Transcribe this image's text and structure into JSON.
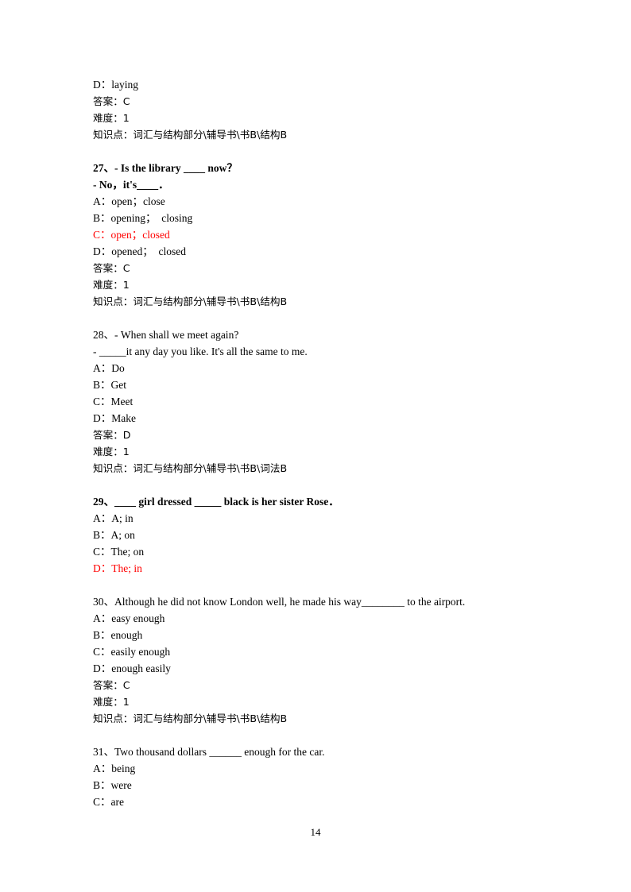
{
  "document": {
    "page_number": "14",
    "accent_color": "#ff0000",
    "text_color": "#000000",
    "background_color": "#ffffff"
  },
  "blocks": [
    {
      "id": "carryover-question",
      "lines": [
        {
          "text": "D：laying",
          "style": "normal",
          "name": "option-line"
        },
        {
          "text": "答案：C",
          "style": "cjk",
          "name": "answer-line"
        },
        {
          "text": "难度：1",
          "style": "cjk",
          "name": "difficulty-line"
        },
        {
          "text": "知识点：词汇与结构部分\\辅导书\\书B\\结构B",
          "style": "cjk",
          "name": "knowledge-point-line"
        }
      ]
    },
    {
      "id": "question-27",
      "lines": [
        {
          "text": "27、- Is the library ____ now？",
          "style": "bold",
          "name": "question-stem"
        },
        {
          "text": "- No，it's____．",
          "style": "bold",
          "name": "question-stem-cont"
        },
        {
          "text": "A：open；close",
          "style": "normal",
          "name": "option-line"
        },
        {
          "text": "B：opening；  closing",
          "style": "normal",
          "name": "option-line"
        },
        {
          "text": "C：open；closed",
          "style": "red",
          "name": "option-line"
        },
        {
          "text": "D：opened；  closed",
          "style": "normal",
          "name": "option-line"
        },
        {
          "text": "答案：C",
          "style": "cjk",
          "name": "answer-line"
        },
        {
          "text": "难度：1",
          "style": "cjk",
          "name": "difficulty-line"
        },
        {
          "text": "知识点：词汇与结构部分\\辅导书\\书B\\结构B",
          "style": "cjk",
          "name": "knowledge-point-line"
        }
      ]
    },
    {
      "id": "question-28",
      "lines": [
        {
          "text": "28、- When shall we meet again?",
          "style": "normal",
          "name": "question-stem"
        },
        {
          "text": "- _____it any day you like. It's all the same to me.",
          "style": "normal",
          "name": "question-stem-cont"
        },
        {
          "text": "A：Do",
          "style": "normal",
          "name": "option-line"
        },
        {
          "text": "B：Get",
          "style": "normal",
          "name": "option-line"
        },
        {
          "text": "C：Meet",
          "style": "normal",
          "name": "option-line"
        },
        {
          "text": "D：Make",
          "style": "normal",
          "name": "option-line"
        },
        {
          "text": "答案：D",
          "style": "cjk",
          "name": "answer-line"
        },
        {
          "text": "难度：1",
          "style": "cjk",
          "name": "difficulty-line"
        },
        {
          "text": "知识点：词汇与结构部分\\辅导书\\书B\\词法B",
          "style": "cjk",
          "name": "knowledge-point-line"
        }
      ]
    },
    {
      "id": "question-29",
      "lines": [
        {
          "text": "29、____ girl dressed _____ black is her sister Rose．",
          "style": "bold",
          "name": "question-stem"
        },
        {
          "text": "A：A; in",
          "style": "normal",
          "name": "option-line"
        },
        {
          "text": "B：A; on",
          "style": "normal",
          "name": "option-line"
        },
        {
          "text": "C：The; on",
          "style": "normal",
          "name": "option-line"
        },
        {
          "text": "D：The; in",
          "style": "red",
          "name": "option-line"
        }
      ]
    },
    {
      "id": "question-30",
      "lines": [
        {
          "text": "30、Although he did not know London well, he made his way________ to the airport.",
          "style": "normal",
          "name": "question-stem"
        },
        {
          "text": "A：easy enough",
          "style": "normal",
          "name": "option-line"
        },
        {
          "text": "B：enough",
          "style": "normal",
          "name": "option-line"
        },
        {
          "text": "C：easily enough",
          "style": "normal",
          "name": "option-line"
        },
        {
          "text": "D：enough easily",
          "style": "normal",
          "name": "option-line"
        },
        {
          "text": "答案：C",
          "style": "cjk",
          "name": "answer-line"
        },
        {
          "text": "难度：1",
          "style": "cjk",
          "name": "difficulty-line"
        },
        {
          "text": "知识点：词汇与结构部分\\辅导书\\书B\\结构B",
          "style": "cjk",
          "name": "knowledge-point-line"
        }
      ]
    },
    {
      "id": "question-31",
      "lines": [
        {
          "text": "31、Two thousand dollars ______ enough for the car.",
          "style": "normal",
          "name": "question-stem"
        },
        {
          "text": "A：being",
          "style": "normal",
          "name": "option-line"
        },
        {
          "text": "B：were",
          "style": "normal",
          "name": "option-line"
        },
        {
          "text": "C：are",
          "style": "normal",
          "name": "option-line"
        }
      ]
    }
  ]
}
